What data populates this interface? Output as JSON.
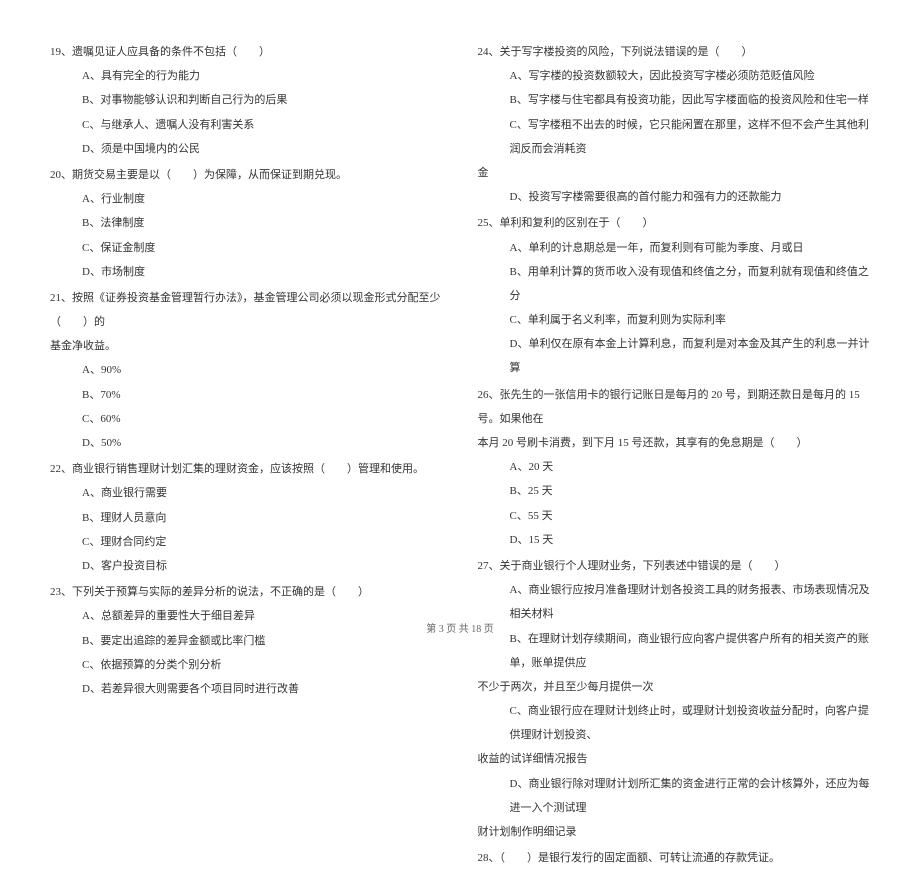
{
  "left": {
    "q19": {
      "text": "19、遗嘱见证人应具备的条件不包括（　　）",
      "a": "A、具有完全的行为能力",
      "b": "B、对事物能够认识和判断自己行为的后果",
      "c": "C、与继承人、遗嘱人没有利害关系",
      "d": "D、须是中国境内的公民"
    },
    "q20": {
      "text": "20、期货交易主要是以（　　）为保障，从而保证到期兑现。",
      "a": "A、行业制度",
      "b": "B、法律制度",
      "c": "C、保证金制度",
      "d": "D、市场制度"
    },
    "q21": {
      "text": "21、按照《证券投资基金管理暂行办法》，基金管理公司必须以现金形式分配至少（　　）的",
      "text2": "基金净收益。",
      "a": "A、90%",
      "b": "B、70%",
      "c": "C、60%",
      "d": "D、50%"
    },
    "q22": {
      "text": "22、商业银行销售理财计划汇集的理财资金，应该按照（　　）管理和使用。",
      "a": "A、商业银行需要",
      "b": "B、理财人员意向",
      "c": "C、理财合同约定",
      "d": "D、客户投资目标"
    },
    "q23": {
      "text": "23、下列关于预算与实际的差异分析的说法，不正确的是（　　）",
      "a": "A、总额差异的重要性大于细目差异",
      "b": "B、要定出追踪的差异金额或比率门槛",
      "c": "C、依据预算的分类个别分析",
      "d": "D、若差异很大则需要各个项目同时进行改善"
    }
  },
  "right": {
    "q24": {
      "text": "24、关于写字楼投资的风险，下列说法错误的是（　　）",
      "a": "A、写字楼的投资数额较大，因此投资写字楼必须防范贬值风险",
      "b": "B、写字楼与住宅都具有投资功能，因此写字楼面临的投资风险和住宅一样",
      "c": "C、写字楼租不出去的时候，它只能闲置在那里，这样不但不会产生其他利润反而会消耗资",
      "c2": "金",
      "d": "D、投资写字楼需要很高的首付能力和强有力的还款能力"
    },
    "q25": {
      "text": "25、单利和复利的区别在于（　　）",
      "a": "A、单利的计息期总是一年，而复利则有可能为季度、月或日",
      "b": "B、用单利计算的货币收入没有现值和终值之分，而复利就有现值和终值之分",
      "c": "C、单利属于名义利率，而复利则为实际利率",
      "d": "D、单利仅在原有本金上计算利息，而复利是对本金及其产生的利息一并计算"
    },
    "q26": {
      "text": "26、张先生的一张信用卡的银行记账日是每月的 20 号，到期还款日是每月的 15 号。如果他在",
      "text2": "本月 20 号刷卡消费，到下月 15 号还款，其享有的免息期是（　　）",
      "a": "A、20 天",
      "b": "B、25 天",
      "c": "C、55 天",
      "d": "D、15 天"
    },
    "q27": {
      "text": "27、关于商业银行个人理财业务，下列表述中错误的是（　　）",
      "a": "A、商业银行应按月准备理财计划各投资工具的财务报表、市场表现情况及相关材料",
      "b": "B、在理财计划存续期间，商业银行应向客户提供客户所有的相关资产的账单，账单提供应",
      "b2": "不少于两次，并且至少每月提供一次",
      "c": "C、商业银行应在理财计划终止时，或理财计划投资收益分配时，向客户提供理财计划投资、",
      "c2": "收益的试详细情况报告",
      "d": "D、商业银行除对理财计划所汇集的资金进行正常的会计核算外，还应为每进一入个测试理",
      "d2": "财计划制作明细记录"
    },
    "q28": {
      "text": "28、（　　）是银行发行的固定面额、可转让流通的存款凭证。"
    }
  },
  "footer": "第 3 页 共 18 页"
}
